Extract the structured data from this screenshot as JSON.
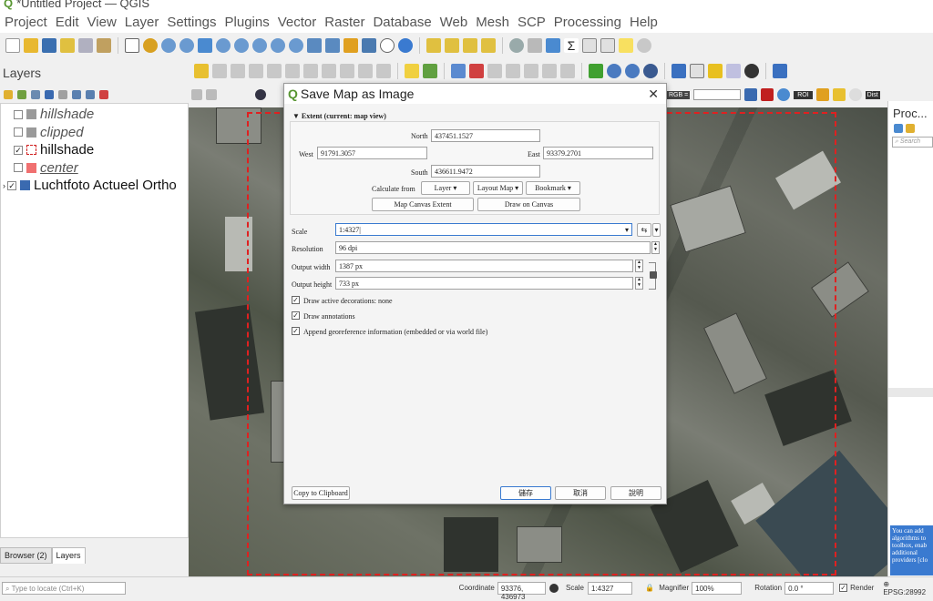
{
  "window": {
    "title": "*Untitled Project — QGIS"
  },
  "menu": [
    "Project",
    "Edit",
    "View",
    "Layer",
    "Settings",
    "Plugins",
    "Vector",
    "Raster",
    "Database",
    "Web",
    "Mesh",
    "SCP",
    "Processing",
    "Help"
  ],
  "layers_panel": {
    "title": "Layers",
    "layers": [
      {
        "name": "hillshade",
        "checked": false,
        "style": "italic"
      },
      {
        "name": "clipped",
        "checked": false,
        "style": "italic"
      },
      {
        "name": "hillshade",
        "checked": true,
        "style": "normal"
      },
      {
        "name": "center",
        "checked": false,
        "style": "italic-underline"
      },
      {
        "name": "Luchtfoto Actueel Ortho",
        "checked": true,
        "style": "normal"
      }
    ],
    "tabs": [
      "Browser (2)",
      "Layers"
    ]
  },
  "toolbar_right": {
    "rgb_label": "RGB =",
    "roi_label": "ROI",
    "dist_label": "Dist"
  },
  "processing_panel": {
    "title": "Proc...",
    "search_placeholder": "Search",
    "note": "You can add algorithms to toolbox, enab additional providers [clo"
  },
  "dialog": {
    "title": "Save Map as Image",
    "extent_header": "Extent (current: map view)",
    "north_label": "North",
    "north": "437451.1527",
    "west_label": "West",
    "west": "91791.3057",
    "east_label": "East",
    "east": "93379.2701",
    "south_label": "South",
    "south": "436611.9472",
    "calc_from": "Calculate from",
    "layer_btn": "Layer",
    "layout_btn": "Layout Map",
    "bookmark_btn": "Bookmark",
    "map_canvas_extent": "Map Canvas Extent",
    "draw_on_canvas": "Draw on Canvas",
    "scale_label": "Scale",
    "scale": "1:4327",
    "resolution_label": "Resolution",
    "resolution": "96 dpi",
    "width_label": "Output width",
    "width": "1387 px",
    "height_label": "Output height",
    "height": "733 px",
    "chk_decorations": "Draw active decorations: none",
    "chk_annotations": "Draw annotations",
    "chk_georef": "Append georeference information (embedded or via world file)",
    "copy_clipboard": "Copy to Clipboard",
    "save": "儲存",
    "cancel": "取消",
    "help": "說明"
  },
  "status": {
    "locate_placeholder": "Type to locate (Ctrl+K)",
    "coordinate_label": "Coordinate",
    "coordinate": "93376, 436973",
    "scale_label": "Scale",
    "scale": "1:4327",
    "magnifier_label": "Magnifier",
    "magnifier": "100%",
    "rotation_label": "Rotation",
    "rotation": "0.0 °",
    "render_label": "Render",
    "crs": "EPSG:28992"
  }
}
